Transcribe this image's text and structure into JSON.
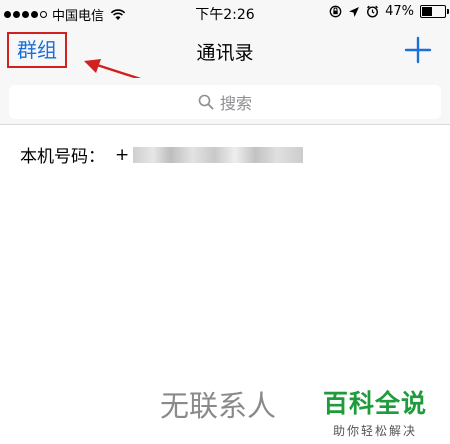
{
  "status_bar": {
    "carrier": "中国电信",
    "time": "下午2:26",
    "battery": "47%",
    "battery_level": 0.47
  },
  "nav": {
    "groups_label": "群组",
    "title": "通讯录"
  },
  "search": {
    "placeholder": "搜索"
  },
  "phone": {
    "label": "本机号码：",
    "value": "+"
  },
  "empty_state": "无联系人",
  "watermark": {
    "title": "百科全说",
    "subtitle": "助你轻松解决"
  },
  "colors": {
    "accent": "#1a6fd8",
    "highlight": "#d02020",
    "watermark": "#1e9b3a"
  }
}
